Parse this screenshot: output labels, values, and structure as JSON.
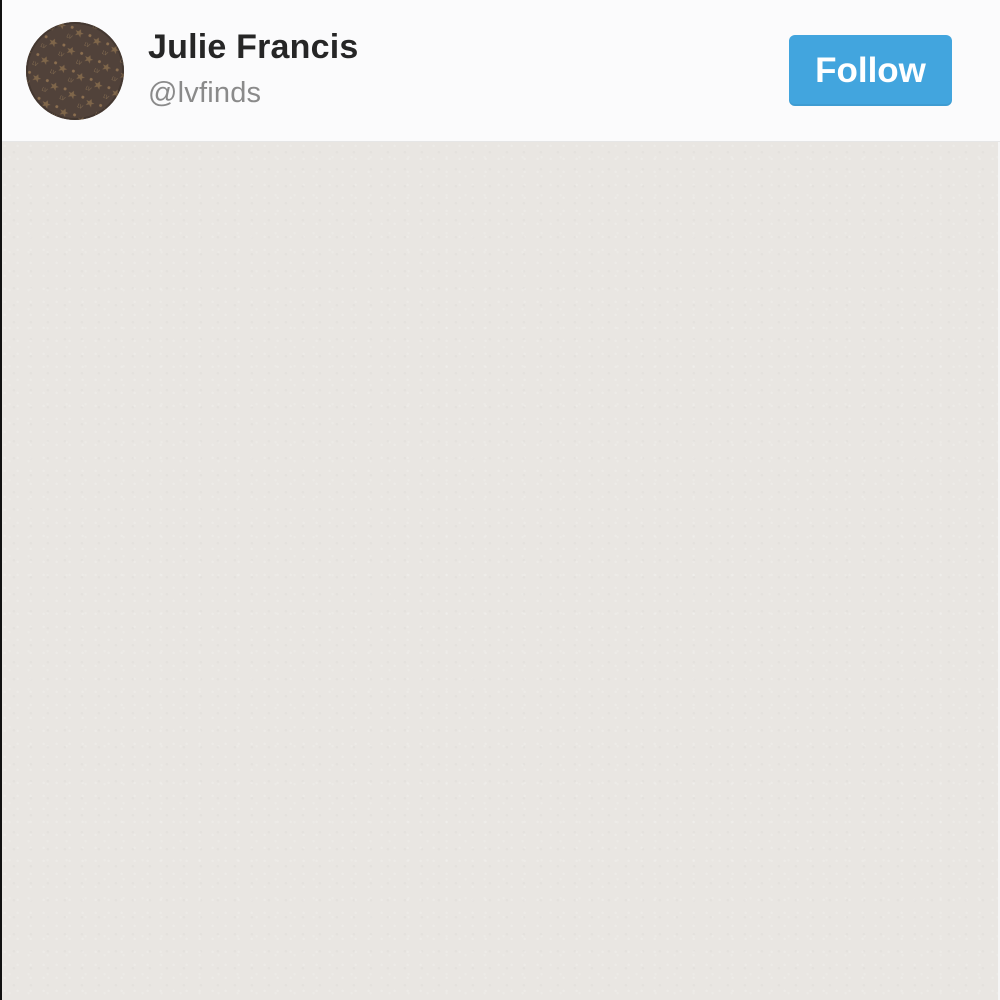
{
  "profile": {
    "name": "Julie Francis",
    "handle": "@lvfinds",
    "avatar_icon": "monogram-avatar-icon"
  },
  "actions": {
    "follow_label": "Follow"
  },
  "colors": {
    "follow_button": "#42a5de",
    "header_background": "#fbfbfc",
    "content_background": "#e9e6e2",
    "avatar_background": "#4f3f36"
  }
}
